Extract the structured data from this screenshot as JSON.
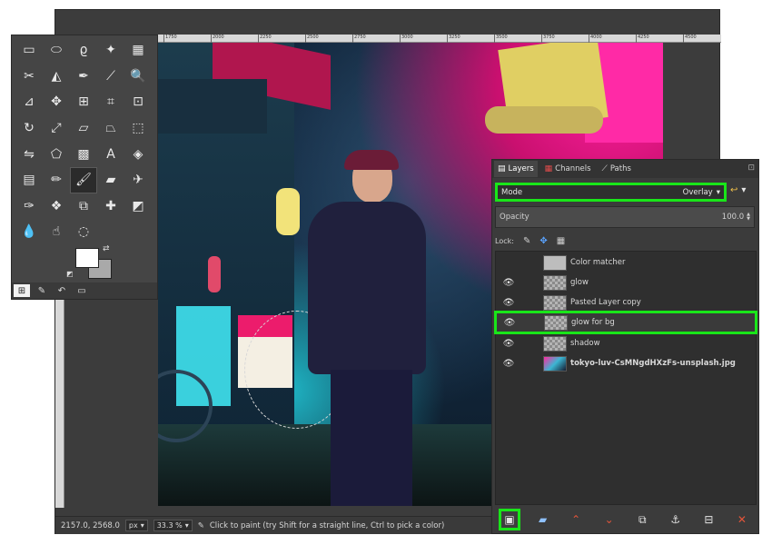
{
  "statusbar": {
    "coords": "2157.0, 2568.0",
    "unit": "px",
    "zoom": "33.3 %",
    "message": "Click to paint (try Shift for a straight line, Ctrl to pick a color)"
  },
  "ruler": {
    "ticks": [
      "1750",
      "2000",
      "2250",
      "2500",
      "2750",
      "3000",
      "3250",
      "3500",
      "3750",
      "4000",
      "4250",
      "4500"
    ]
  },
  "toolbox": {
    "tools": [
      {
        "icon": "rect-select-icon",
        "glyph": "▭"
      },
      {
        "icon": "ellipse-select-icon",
        "glyph": "⬭"
      },
      {
        "icon": "free-select-icon",
        "glyph": "ϱ"
      },
      {
        "icon": "fuzzy-select-icon",
        "glyph": "✦"
      },
      {
        "icon": "select-by-color-icon",
        "glyph": "▦"
      },
      {
        "icon": "scissors-select-icon",
        "glyph": "✂"
      },
      {
        "icon": "foreground-select-icon",
        "glyph": "◭"
      },
      {
        "icon": "paths-icon",
        "glyph": "✒"
      },
      {
        "icon": "color-picker-icon",
        "glyph": "⟋"
      },
      {
        "icon": "zoom-icon",
        "glyph": "🔍"
      },
      {
        "icon": "measure-icon",
        "glyph": "⊿"
      },
      {
        "icon": "move-icon",
        "glyph": "✥"
      },
      {
        "icon": "alignment-icon",
        "glyph": "⊞"
      },
      {
        "icon": "crop-icon",
        "glyph": "⌗"
      },
      {
        "icon": "transform-icon",
        "glyph": "⊡"
      },
      {
        "icon": "rotate-icon",
        "glyph": "↻"
      },
      {
        "icon": "scale-icon",
        "glyph": "⤢"
      },
      {
        "icon": "shear-icon",
        "glyph": "▱"
      },
      {
        "icon": "perspective-icon",
        "glyph": "⏢"
      },
      {
        "icon": "handle-transform-icon",
        "glyph": "⬚"
      },
      {
        "icon": "flip-icon",
        "glyph": "⇋"
      },
      {
        "icon": "cage-icon",
        "glyph": "⬠"
      },
      {
        "icon": "warp-icon",
        "glyph": "▩"
      },
      {
        "icon": "text-icon",
        "glyph": "A"
      },
      {
        "icon": "bucket-fill-icon",
        "glyph": "◈"
      },
      {
        "icon": "gradient-icon",
        "glyph": "▤"
      },
      {
        "icon": "pencil-icon",
        "glyph": "✏"
      },
      {
        "icon": "paintbrush-icon",
        "glyph": "🖌"
      },
      {
        "icon": "eraser-icon",
        "glyph": "▰"
      },
      {
        "icon": "airbrush-icon",
        "glyph": "✈"
      },
      {
        "icon": "ink-icon",
        "glyph": "✑"
      },
      {
        "icon": "mypaint-brush-icon",
        "glyph": "❖"
      },
      {
        "icon": "clone-icon",
        "glyph": "⧉"
      },
      {
        "icon": "heal-icon",
        "glyph": "✚"
      },
      {
        "icon": "perspective-clone-icon",
        "glyph": "◩"
      },
      {
        "icon": "blur-icon",
        "glyph": "💧"
      },
      {
        "icon": "smudge-icon",
        "glyph": "☝"
      },
      {
        "icon": "dodge-burn-icon",
        "glyph": "◌"
      }
    ],
    "active_tool": 27,
    "fg_color": "#ffffff",
    "bg_color": "#a9a9a9"
  },
  "dock": {
    "tabs": [
      {
        "label": "Layers",
        "icon": "layers-tab-icon",
        "glyph": "▤"
      },
      {
        "label": "Channels",
        "icon": "channels-tab-icon",
        "glyph": "▦"
      },
      {
        "label": "Paths",
        "icon": "paths-tab-icon",
        "glyph": "⟋"
      }
    ],
    "mode_label": "Mode",
    "mode_value": "Overlay",
    "opacity_label": "Opacity",
    "opacity_value": "100.0",
    "lock_label": "Lock:"
  },
  "layers": [
    {
      "name": "Color matcher",
      "visible": false,
      "thumb": "gray",
      "selected": false,
      "bold": false
    },
    {
      "name": "glow",
      "visible": true,
      "thumb": "checker",
      "selected": false,
      "bold": false
    },
    {
      "name": "Pasted Layer copy",
      "visible": true,
      "thumb": "checker",
      "selected": false,
      "bold": false
    },
    {
      "name": "glow for bg",
      "visible": true,
      "thumb": "checker",
      "selected": true,
      "bold": false
    },
    {
      "name": "shadow",
      "visible": true,
      "thumb": "checker",
      "selected": false,
      "bold": false
    },
    {
      "name": "tokyo-luv-CsMNgdHXzFs-unsplash.jpg",
      "visible": true,
      "thumb": "photo",
      "selected": false,
      "bold": true
    }
  ],
  "highlight_color": "#19e619"
}
